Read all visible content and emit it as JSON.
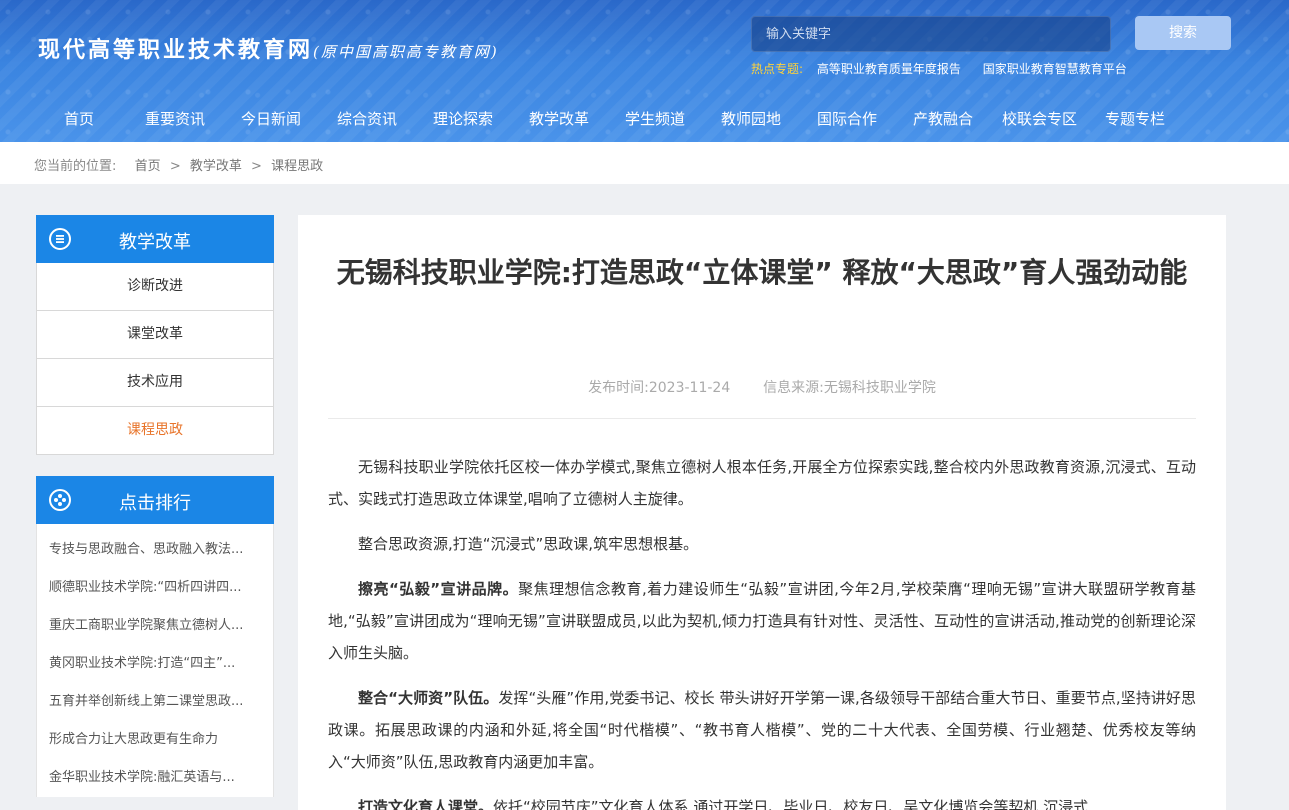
{
  "header": {
    "logo_main": "现代高等职业技术教育网",
    "logo_sub": "(原中国高职高专教育网)",
    "search_placeholder": "输入关键字",
    "search_button": "搜索",
    "hot_label": "热点专题:",
    "hot_items": [
      "高等职业教育质量年度报告",
      "国家职业教育智慧教育平台"
    ]
  },
  "nav": [
    "首页",
    "重要资讯",
    "今日新闻",
    "综合资讯",
    "理论探索",
    "教学改革",
    "学生频道",
    "教师园地",
    "国际合作",
    "产教融合",
    "校联会专区",
    "专题专栏"
  ],
  "breadcrumb": {
    "label": "您当前的位置:",
    "items": [
      "首页",
      "教学改革",
      "课程思政"
    ],
    "separator": ">"
  },
  "sidebar": {
    "category_title": "教学改革",
    "category_items": [
      "诊断改进",
      "课堂改革",
      "技术应用",
      "课程思政"
    ],
    "active_item": "课程思政",
    "ranking_title": "点击排行",
    "ranking_items": [
      "专技与思政融合、思政融入教法...",
      "顺德职业技术学院:“四析四讲四...",
      "重庆工商职业学院聚焦立德树人...",
      "黄冈职业技术学院:打造“四主”...",
      "五育并举创新线上第二课堂思政...",
      "形成合力让大思政更有生命力",
      "金华职业技术学院:融汇英语与..."
    ]
  },
  "article": {
    "title": "无锡科技职业学院:打造思政“立体课堂” 释放“大思政”育人强劲动能",
    "date_label": "发布时间:",
    "date": "2023-11-24",
    "source_label": "信息来源:",
    "source": "无锡科技职业学院",
    "p1": "无锡科技职业学院依托区校一体办学模式,聚焦立德树人根本任务,开展全方位探索实践,整合校内外思政教育资源,沉浸式、互动式、实践式打造思政立体课堂,唱响了立德树人主旋律。",
    "p2": "整合思政资源,打造“沉浸式”思政课,筑牢思想根基。",
    "p3_lead": "擦亮“弘毅”宣讲品牌。",
    "p3": "聚焦理想信念教育,着力建设师生“弘毅”宣讲团,今年2月,学校荣膺“理响无锡”宣讲大联盟研学教育基地,“弘毅”宣讲团成为“理响无锡”宣讲联盟成员,以此为契机,倾力打造具有针对性、灵活性、互动性的宣讲活动,推动党的创新理论深入师生头脑。",
    "p4_lead": "整合“大师资”队伍。",
    "p4": "发挥“头雁”作用,党委书记、校长 带头讲好开学第一课,各级领导干部结合重大节日、重要节点,坚持讲好思政课。拓展思政课的内涵和外延,将全国“时代楷模”、“教书育人楷模”、党的二十大代表、全国劳模、行业翘楚、优秀校友等纳入“大师资”队伍,思政教育内涵更加丰富。",
    "p5_lead": "打造文化育人课堂。",
    "p5": "依托“校园节庆”文化育人体系,通过开学日、毕业日、校友日、吴文化博览会等契机,沉浸式"
  },
  "colors": {
    "accent": "#1b86e6",
    "active": "#e8742a",
    "hot_label": "#ffd33a"
  }
}
